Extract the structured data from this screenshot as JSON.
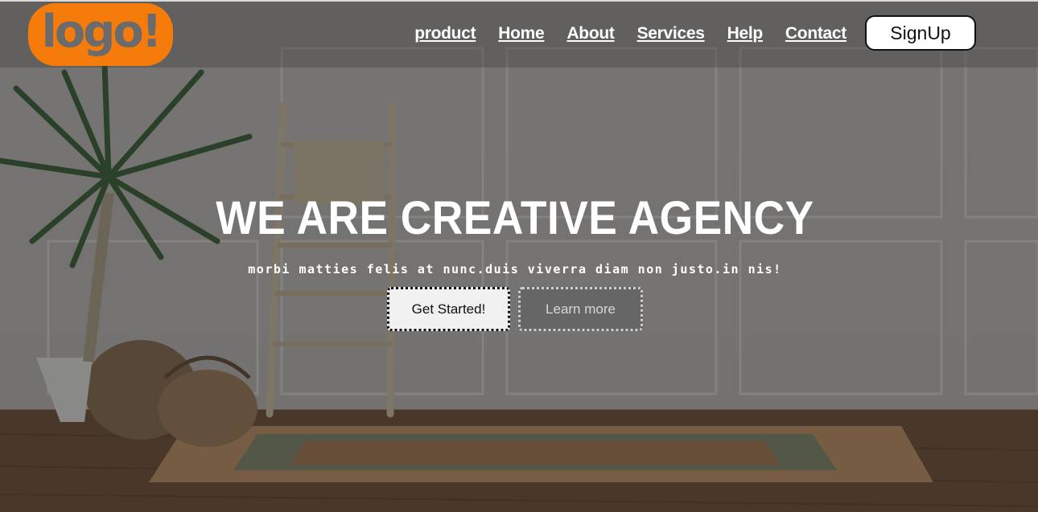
{
  "logo": {
    "text": "logo!"
  },
  "nav": {
    "items": [
      "product",
      "Home",
      "About",
      "Services",
      "Help",
      "Contact"
    ],
    "signup_label": "SignUp"
  },
  "hero": {
    "title": "WE ARE CREATIVE AGENCY",
    "subtitle": "morbi matties felis at nunc.duis viverra diam non justo.in nis!",
    "primary_button": "Get Started!",
    "secondary_button": "Learn more"
  },
  "colors": {
    "logo_bg": "#f57c0a",
    "logo_text": "#6b6b6b",
    "text": "#ffffff",
    "primary_button_bg": "#f0f0f0",
    "secondary_button_bg": "#666666"
  }
}
